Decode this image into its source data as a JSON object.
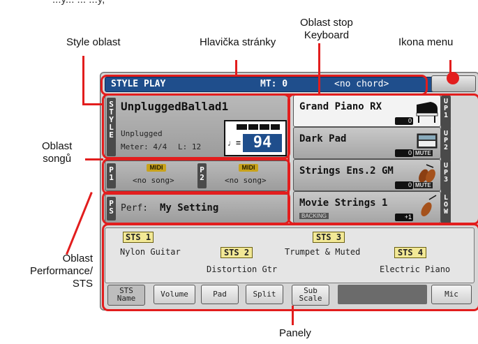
{
  "callouts": {
    "top_partial": "...y... ... ...y,",
    "keyboard_area": "Oblast stop\nKeyboard",
    "style_area": "Style oblast",
    "page_header": "Hlavička stránky",
    "menu_icon": "Ikona menu",
    "song_area": "Oblast\nsongů",
    "performance_area": "Oblast\nPerformance/\nSTS",
    "panels": "Panely"
  },
  "header": {
    "mode": "STYLE PLAY",
    "mt": "MT: 0",
    "chord": "<no chord>"
  },
  "style": {
    "tag": "STYLE",
    "name": "UnpluggedBallad1",
    "category": "Unplugged",
    "meter": "Meter: 4/4",
    "length": "L: 12",
    "tempo_symbol": "♩=",
    "tempo": "94"
  },
  "songs": [
    {
      "tag": "P1",
      "midi": "MIDI",
      "name": "<no song>"
    },
    {
      "tag": "P2",
      "midi": "MIDI",
      "name": "<no song>"
    }
  ],
  "performance": {
    "tag": "PS",
    "label": "Perf:",
    "value": "My Setting"
  },
  "keyboard_tracks": [
    {
      "name": "Grand Piano RX",
      "octave": "0",
      "tag": "UP1",
      "mute": ""
    },
    {
      "name": "Dark Pad",
      "octave": "0",
      "tag": "UP2",
      "mute": "MUTE"
    },
    {
      "name": "Strings Ens.2 GM",
      "octave": "0",
      "tag": "UP3",
      "mute": "MUTE"
    },
    {
      "name": "Movie Strings 1",
      "octave": "+1",
      "tag": "LOW",
      "mute": "",
      "sub": "BACKING"
    }
  ],
  "sts": [
    {
      "label": "STS 1",
      "sound": "Nylon Guitar"
    },
    {
      "label": "STS 2",
      "sound": "Distortion Gtr"
    },
    {
      "label": "STS 3",
      "sound": "Trumpet & Muted"
    },
    {
      "label": "STS 4",
      "sound": "Electric Piano"
    }
  ],
  "tabs": [
    "STS\nName",
    "Volume",
    "Pad",
    "Split",
    "Sub\nScale",
    "Mic"
  ],
  "colors": {
    "annotation": "#e21d1d",
    "header_bg": "#1f4e8c",
    "sts_button": "#f2e896",
    "midi_badge": "#c8a21a"
  }
}
